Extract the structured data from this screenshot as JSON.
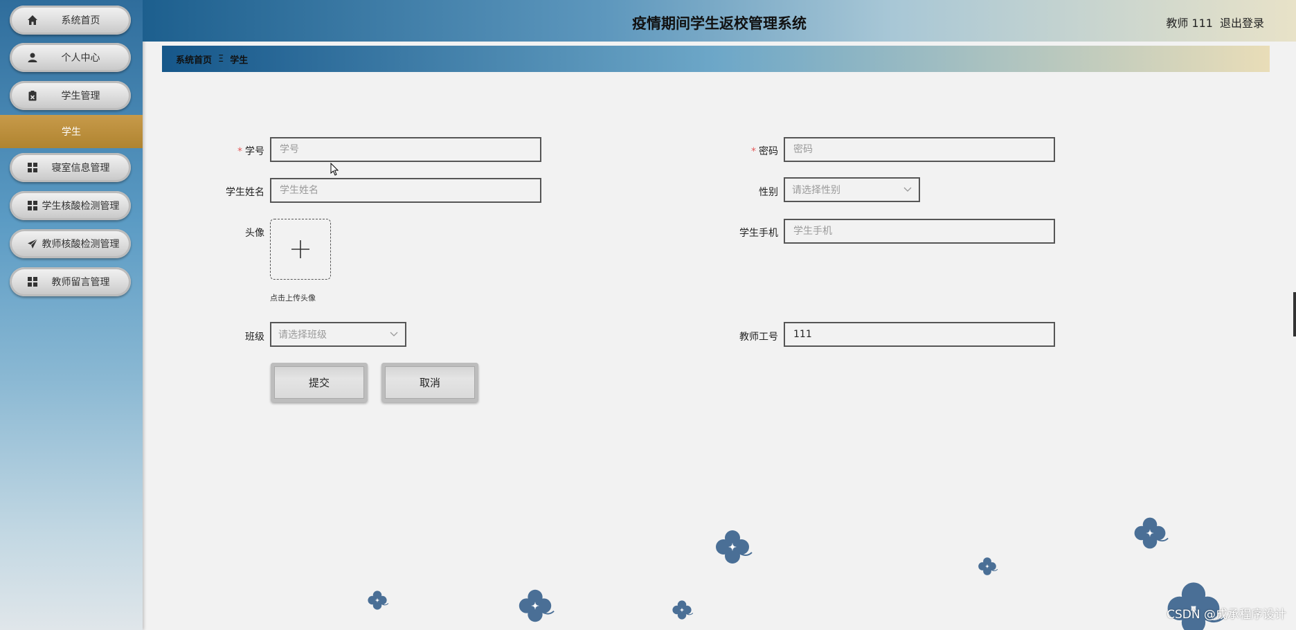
{
  "header": {
    "title": "疫情期间学生返校管理系统",
    "user": "教师 111",
    "logout": "退出登录"
  },
  "sidebar": {
    "items": [
      {
        "label": "系统首页",
        "icon": "home-icon"
      },
      {
        "label": "个人中心",
        "icon": "user-icon"
      },
      {
        "label": "学生管理",
        "icon": "clipboard-icon"
      },
      {
        "label": "寝室信息管理",
        "icon": "grid-icon"
      },
      {
        "label": "学生核酸检测管理",
        "icon": "grid-icon"
      },
      {
        "label": "教师核酸检测管理",
        "icon": "send-icon"
      },
      {
        "label": "教师留言管理",
        "icon": "grid-icon"
      }
    ],
    "active_sub": "学生"
  },
  "breadcrumb": {
    "home": "系统首页",
    "separator": "Ξ",
    "current": "学生"
  },
  "form": {
    "student_id": {
      "label": "学号",
      "placeholder": "学号",
      "required": true
    },
    "password": {
      "label": "密码",
      "placeholder": "密码",
      "required": true
    },
    "student_name": {
      "label": "学生姓名",
      "placeholder": "学生姓名"
    },
    "gender": {
      "label": "性别",
      "placeholder": "请选择性别"
    },
    "avatar": {
      "label": "头像",
      "hint": "点击上传头像"
    },
    "student_phone": {
      "label": "学生手机",
      "placeholder": "学生手机"
    },
    "class": {
      "label": "班级",
      "placeholder": "请选择班级"
    },
    "teacher_id": {
      "label": "教师工号",
      "value": "111"
    },
    "submit": "提交",
    "cancel": "取消"
  },
  "watermark": "CSDN @成承程序设计",
  "colors": {
    "flower": "#4a6f96",
    "accent": "#c79a4a",
    "required": "#e45a5a"
  }
}
